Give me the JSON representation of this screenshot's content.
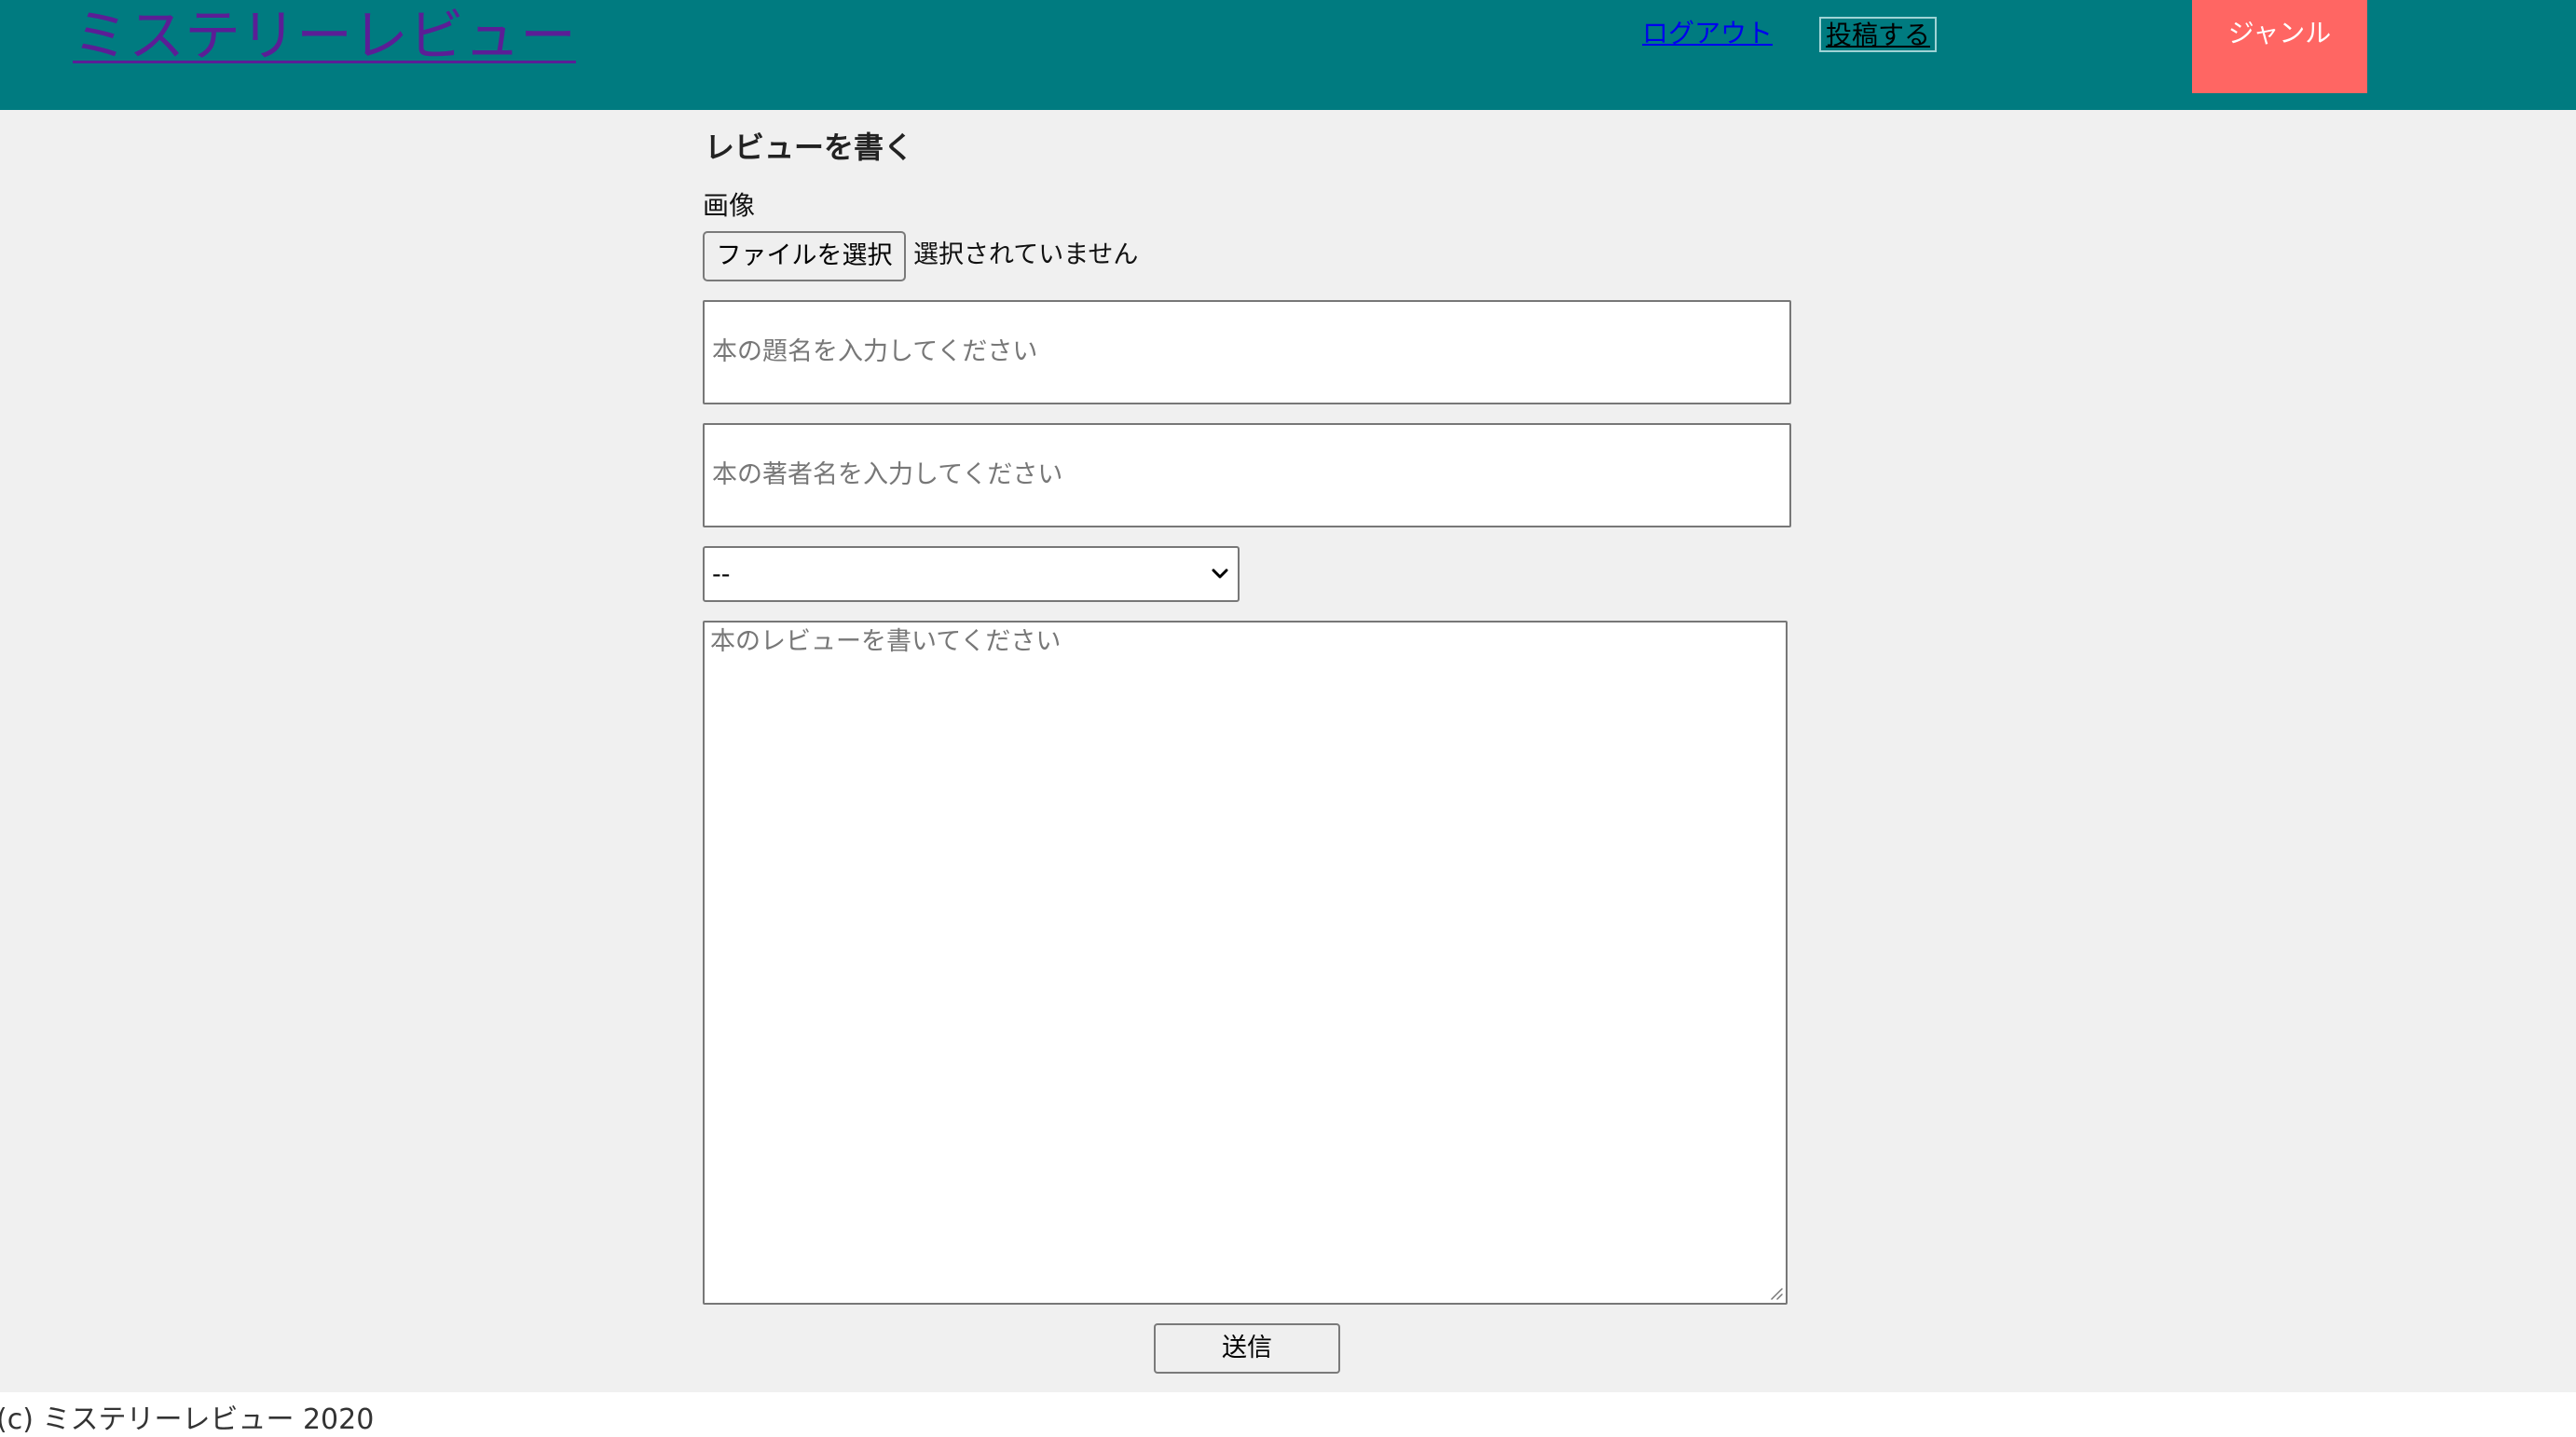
{
  "header": {
    "site_title": "ミステリーレビュー",
    "logout_label": "ログアウト",
    "post_label": "投稿する",
    "genre_label": "ジャンル"
  },
  "form": {
    "title": "レビューを書く",
    "image_label": "画像",
    "file_button_label": "ファイルを選択",
    "file_status": "選択されていません",
    "book_title_placeholder": "本の題名を入力してください",
    "author_placeholder": "本の著者名を入力してください",
    "genre_select_value": "--",
    "review_placeholder": "本のレビューを書いてください",
    "submit_label": "送信"
  },
  "footer": {
    "text": "(c) ミステリーレビュー 2020"
  },
  "colors": {
    "header_bg": "#007b80",
    "genre_bg": "#ff6663",
    "title_link": "#5b1e96",
    "nav_link": "#0000ee",
    "page_bg": "#f0f0f0"
  }
}
